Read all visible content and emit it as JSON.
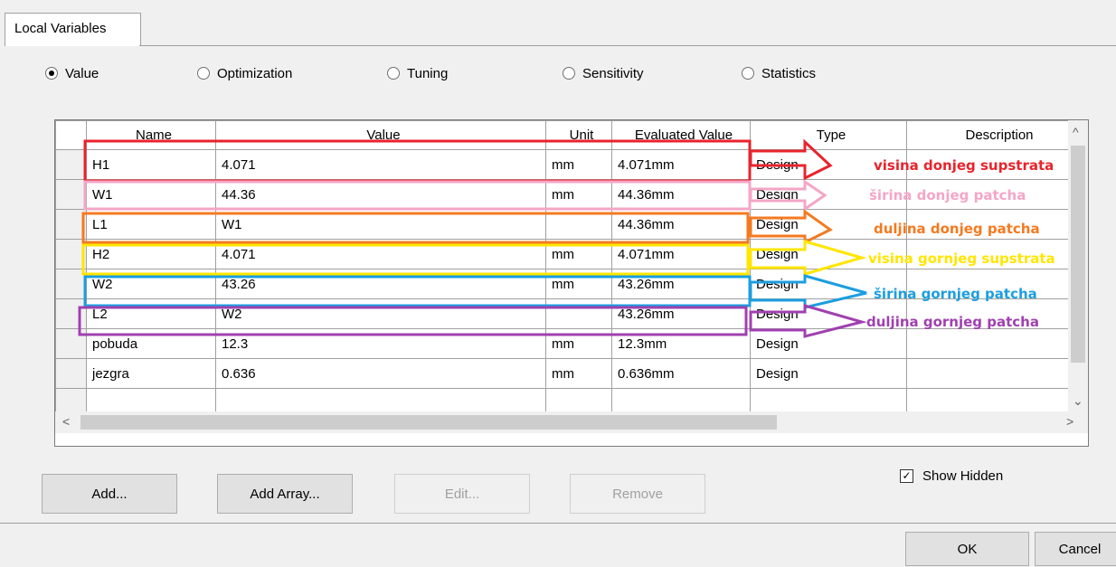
{
  "tab": {
    "label": "Local Variables"
  },
  "radios": [
    {
      "label": "Value",
      "selected": true
    },
    {
      "label": "Optimization",
      "selected": false
    },
    {
      "label": "Tuning",
      "selected": false
    },
    {
      "label": "Sensitivity",
      "selected": false
    },
    {
      "label": "Statistics",
      "selected": false
    }
  ],
  "table": {
    "headers": [
      "Name",
      "Value",
      "Unit",
      "Evaluated Value",
      "Type",
      "Description"
    ],
    "rows": [
      {
        "name": "H1",
        "value": "4.071",
        "unit": "mm",
        "evaluated": "4.071mm",
        "type": "Design"
      },
      {
        "name": "W1",
        "value": "44.36",
        "unit": "mm",
        "evaluated": "44.36mm",
        "type": "Design"
      },
      {
        "name": "L1",
        "value": "W1",
        "unit": "",
        "evaluated": "44.36mm",
        "type": "Design"
      },
      {
        "name": "H2",
        "value": "4.071",
        "unit": "mm",
        "evaluated": "4.071mm",
        "type": "Design"
      },
      {
        "name": "W2",
        "value": "43.26",
        "unit": "mm",
        "evaluated": "43.26mm",
        "type": "Design"
      },
      {
        "name": "L2",
        "value": "W2",
        "unit": "",
        "evaluated": "43.26mm",
        "type": "Design"
      },
      {
        "name": "pobuda",
        "value": "12.3",
        "unit": "mm",
        "evaluated": "12.3mm",
        "type": "Design"
      },
      {
        "name": "jezgra",
        "value": "0.636",
        "unit": "mm",
        "evaluated": "0.636mm",
        "type": "Design"
      },
      {
        "name": "",
        "value": "",
        "unit": "",
        "evaluated": "",
        "type": ""
      }
    ]
  },
  "annotations": [
    {
      "text": "visina donjeg supstrata",
      "color": "#e8232c"
    },
    {
      "text": "širina donjeg patcha",
      "color": "#f4a6c6"
    },
    {
      "text": "duljina donjeg patcha",
      "color": "#f47a20"
    },
    {
      "text": "visina gornjeg supstrata",
      "color": "#ffe600"
    },
    {
      "text": "širina gornjeg patcha",
      "color": "#1c9ee0"
    },
    {
      "text": "duljina gornjeg patcha",
      "color": "#a040b0"
    }
  ],
  "buttons": {
    "add": "Add...",
    "add_array": "Add Array...",
    "edit": "Edit...",
    "remove": "Remove",
    "ok": "OK",
    "cancel": "Cancel"
  },
  "show_hidden": {
    "label": "Show Hidden",
    "checked": true
  }
}
